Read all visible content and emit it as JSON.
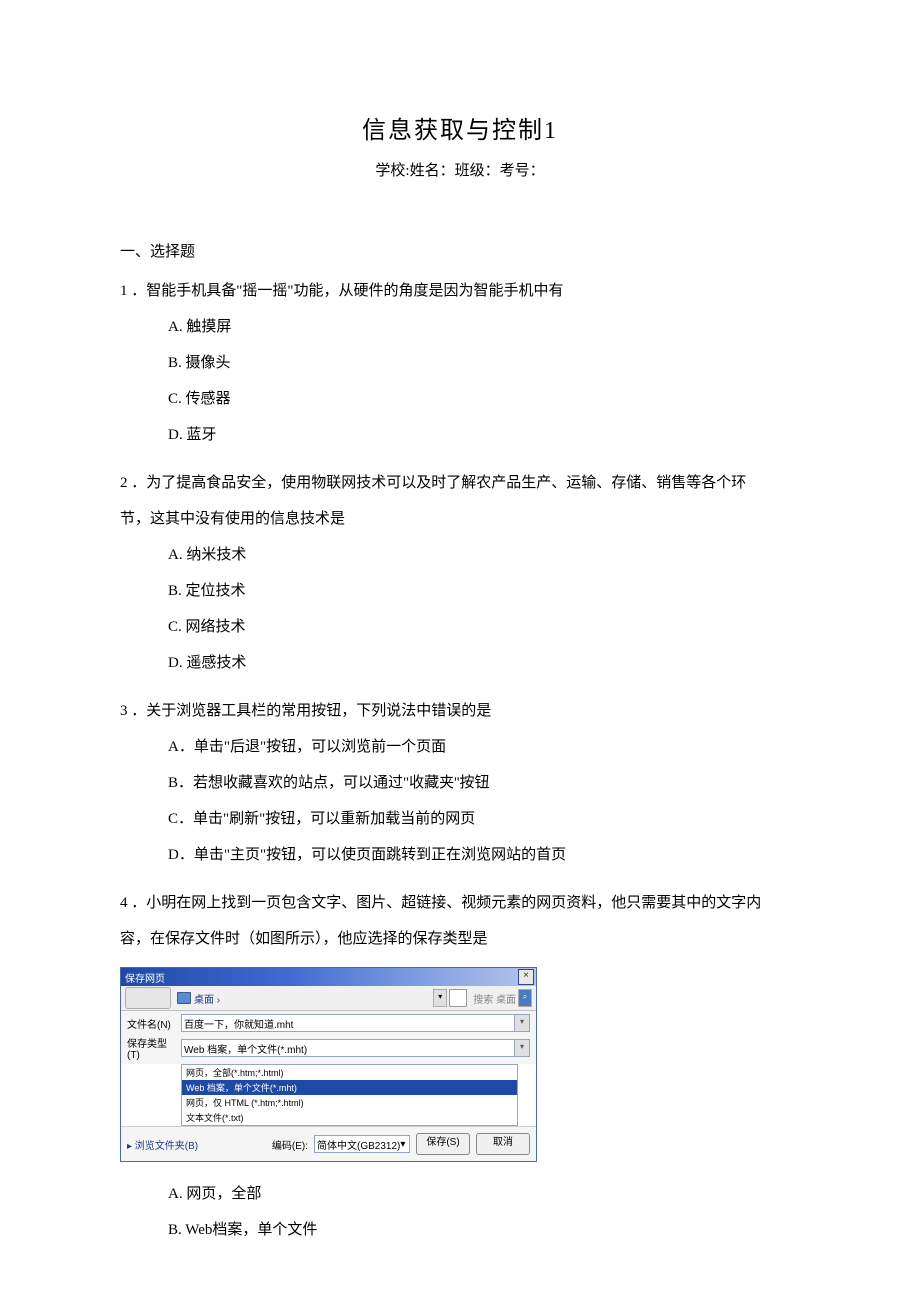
{
  "title": "信息获取与控制1",
  "header": "学校:姓名：班级：考号：",
  "section_header": "一、选择题",
  "q1": {
    "stem": "1 ．智能手机具备\"摇一摇\"功能，从硬件的角度是因为智能手机中有",
    "A": "A. 触摸屏",
    "B": "B. 摄像头",
    "C": "C. 传感器",
    "D": "D. 蓝牙"
  },
  "q2": {
    "stem_a": "2 ．为了提高食品安全，使用物联网技术可以及时了解农产品生产、运输、存储、销售等各个环",
    "stem_b": "节，这其中没有使用的信息技术是",
    "A": "A. 纳米技术",
    "B": "B. 定位技术",
    "C": "C. 网络技术",
    "D": "D. 遥感技术"
  },
  "q3": {
    "stem": "3 ．关于浏览器工具栏的常用按钮，下列说法中错误的是",
    "A": "A．单击\"后退\"按钮，可以浏览前一个页面",
    "B": "B．若想收藏喜欢的站点，可以通过\"收藏夹''按钮",
    "C": "C．单击\"刷新\"按钮，可以重新加载当前的网页",
    "D": "D．单击\"主页\"按钮，可以使页面跳转到正在浏览网站的首页"
  },
  "q4": {
    "stem_a": "4 ．小明在网上找到一页包含文字、图片、超链接、视频元素的网页资料，他只需要其中的文字内",
    "stem_b": "容，在保存文件时（如图所示），他应选择的保存类型是",
    "A": "A. 网页，全部",
    "B": "B. Web档案，单个文件"
  },
  "dialog": {
    "title": "保存网页",
    "nav_location": "桌面 ›",
    "search_placeholder": "搜索 桌面",
    "filename_label": "文件名(N)",
    "filename_value": "百度一下，你就知道.mht",
    "savetype_label": "保存类型(T)",
    "savetype_value": "Web 档案，单个文件(*.mht)",
    "options": [
      "网页，全部(*.htm;*.html)",
      "Web 档案，单个文件(*.mht)",
      "网页，仅 HTML (*.htm;*.html)",
      "文本文件(*.txt)"
    ],
    "hide_folders": "▸ 浏览文件夹(B)",
    "encoding_label": "编码(E):",
    "encoding_value": "简体中文(GB2312)",
    "save_btn": "保存(S)",
    "cancel_btn": "取消"
  }
}
